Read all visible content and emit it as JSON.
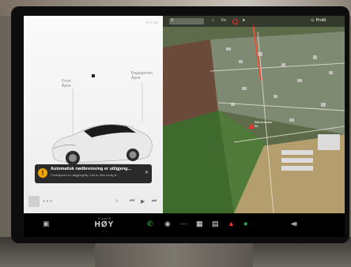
{
  "status_bar": {
    "text": "□ − ○○"
  },
  "car_panel": {
    "label_left": {
      "line1": "Front",
      "line2": "Åpne"
    },
    "label_right": {
      "line1": "Bagasjerom",
      "line2": "Åpne"
    },
    "alert": {
      "icon": "warning-icon",
      "title": "Automatisk nødbremsing er utilgjeng...",
      "subtitle": "Funksjonen er utilgjengelig. Det er ikke mulig å...",
      "close": "✕"
    },
    "media": {
      "source": "● ● ●",
      "controls": [
        "♪",
        "⏮",
        "▶",
        "⏭"
      ]
    }
  },
  "map": {
    "search_icon": "search-icon",
    "places": [
      "⌂",
      "Fo",
      "★"
    ],
    "profile": "☺ Profil",
    "pin_label": [
      "Bilforhandler",
      "Bil"
    ]
  },
  "dock": {
    "car_icon": "car-icon",
    "temp_top": "❄ auto ❄",
    "temp_value": "HØY",
    "temp_bottom": "‹ · ›",
    "icons": [
      "phone-icon",
      "camera-icon",
      "dots-icon",
      "calendar-icon",
      "notes-icon",
      "joystick-icon",
      "spotify-icon"
    ],
    "volume": "◀▮"
  },
  "colors": {
    "accent_alert": "#f0a500",
    "route": "#e8513a",
    "phone": "#2ecc40"
  }
}
